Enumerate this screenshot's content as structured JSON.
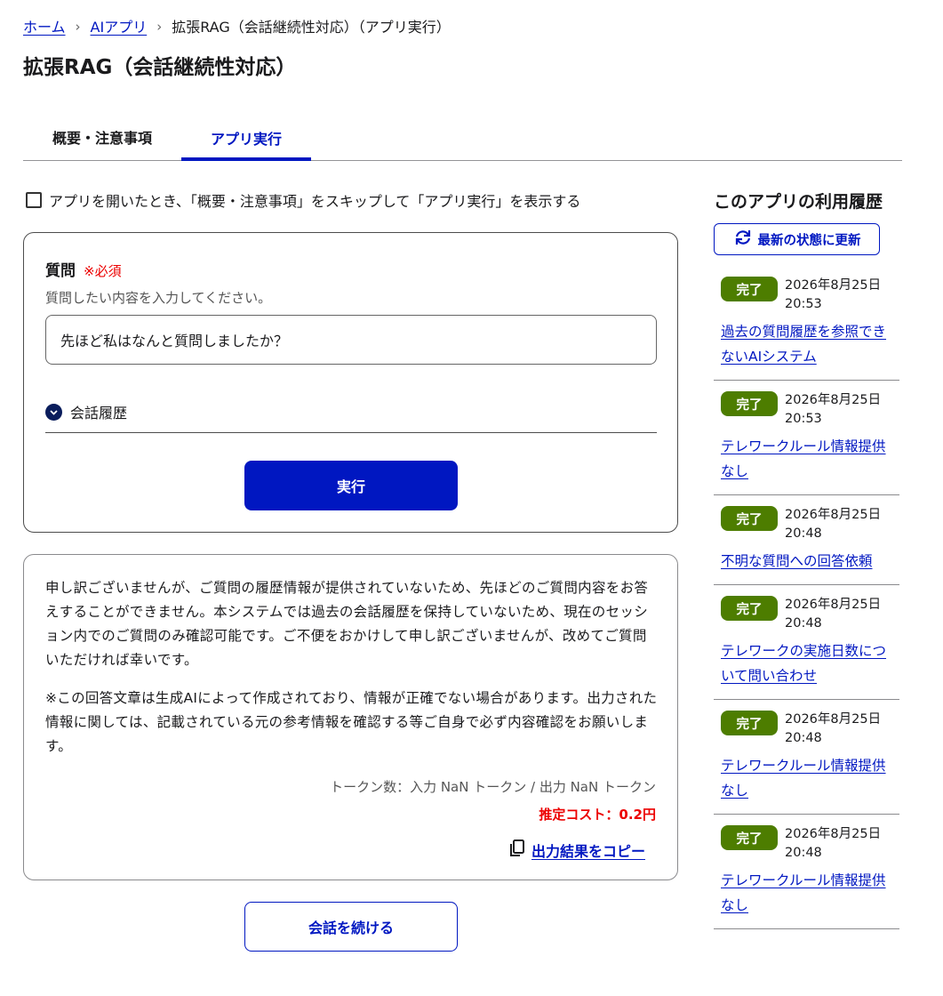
{
  "breadcrumb": {
    "home": "ホーム",
    "ai_apps": "AIアプリ",
    "current": "拡張RAG（会話継続性対応）（アプリ実行）"
  },
  "page_title": "拡張RAG（会話継続性対応）",
  "tabs": [
    {
      "label": "概要・注意事項"
    },
    {
      "label": "アプリ実行",
      "active": true
    }
  ],
  "skip_option": {
    "label": "アプリを開いたとき、「概要・注意事項」をスキップして「アプリ実行」を表示する",
    "checked": false
  },
  "form": {
    "question_label": "質問",
    "required_mark": "※必須",
    "help_text": "質問したい内容を入力してください。",
    "question_value": "先ほど私はなんと質問しましたか？",
    "history_toggle": "会話履歴",
    "run_button": "実行"
  },
  "answer": {
    "text": "申し訳ございませんが、ご質問の履歴情報が提供されていないため、先ほどのご質問内容をお答えすることができません。本システムでは過去の会話履歴を保持していないため、現在のセッション内でのご質問のみ確認可能です。ご不便をおかけして申し訳ございませんが、改めてご質問いただければ幸いです。",
    "note": "※この回答文章は生成AIによって作成されており、情報が正確でない場合があります。出力された情報に関しては、記載されている元の参考情報を確認する等ご自身で必ず内容確認をお願いします。",
    "tokens": "トークン数：入力 NaN トークン / 出力 NaN トークン",
    "cost": "推定コスト：0.2円",
    "copy_label": "出力結果をコピー"
  },
  "continue_button": "会話を続ける",
  "sidebar": {
    "title": "このアプリの利用履歴",
    "refresh_label": "最新の状態に更新",
    "items": [
      {
        "status": "完了",
        "date": "2026年8月25日 20:53",
        "title": "過去の質問履歴を参照できないAIシステム"
      },
      {
        "status": "完了",
        "date": "2026年8月25日 20:53",
        "title": "テレワークルール情報提供なし"
      },
      {
        "status": "完了",
        "date": "2026年8月25日 20:48",
        "title": "不明な質問への回答依頼"
      },
      {
        "status": "完了",
        "date": "2026年8月25日 20:48",
        "title": "テレワークの実施日数について問い合わせ"
      },
      {
        "status": "完了",
        "date": "2026年8月25日 20:48",
        "title": "テレワークルール情報提供なし"
      },
      {
        "status": "完了",
        "date": "2026年8月25日 20:48",
        "title": "テレワークルール情報提供なし"
      }
    ]
  },
  "colors": {
    "primary": "#0017c1",
    "required": "#ec0000",
    "status_done": "#4d7d00",
    "toggle_icon": "#0a1d5c"
  }
}
